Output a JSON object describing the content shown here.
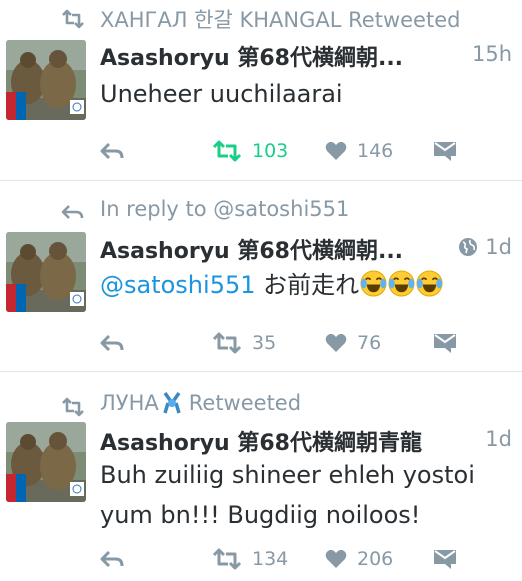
{
  "colors": {
    "accent_blue": "#1b95e0",
    "retweet_green": "#19cf86",
    "muted": "#8899a6",
    "text": "#292f33"
  },
  "tweets": [
    {
      "context": {
        "icon": "retweet-icon",
        "text": "ХАНГАЛ 한갈 KHANGAL Retweeted"
      },
      "author": "Asashoryu 第68代横綱朝...",
      "time": "15h",
      "text": "Uneheer uuchilaarai",
      "actions": {
        "retweet_count": "103",
        "like_count": "146",
        "retweeted": true
      }
    },
    {
      "context": {
        "icon": "reply-icon",
        "text": "In reply to @satoshi551"
      },
      "author": "Asashoryu 第68代横綱朝...",
      "time": "1d",
      "globe": "globe-icon",
      "text_mention": "@satoshi551",
      "text": " お前走れ",
      "emoji": [
        "laughing-tears-emoji",
        "laughing-tears-emoji",
        "laughing-tears-emoji"
      ],
      "actions": {
        "retweet_count": "35",
        "like_count": "76",
        "retweeted": false
      }
    },
    {
      "context": {
        "icon": "retweet-icon",
        "name": "ЛУНА",
        "badge": "ribbon-icon",
        "suffix": "Retweeted"
      },
      "author": "Asashoryu 第68代横綱朝青龍",
      "time": "1d",
      "text_line1": "Buh zuiliig shineer ehleh yostoi",
      "text_line2": "yum bn!!! Bugdiig noiloos!",
      "actions": {
        "retweet_count": "134",
        "like_count": "206",
        "retweeted": false
      }
    }
  ]
}
